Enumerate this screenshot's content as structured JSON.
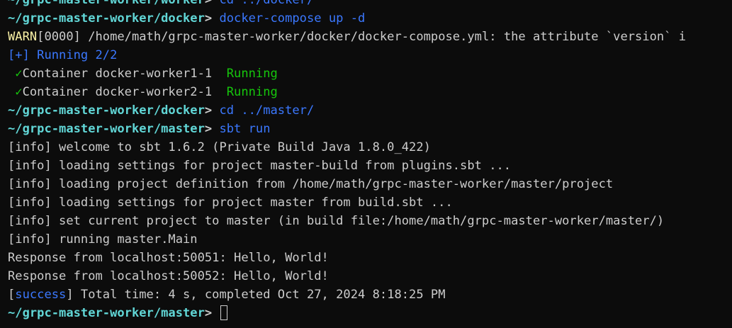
{
  "lines": [
    {
      "path": "~/grpc-master-worker/worker",
      "sym": ">",
      "cmd1": "cd",
      "cmd2": " ../docker/"
    },
    {
      "path": "~/grpc-master-worker/docker",
      "sym": ">",
      "cmd1": "docker-compose",
      "cmd2": " up -d"
    },
    {
      "warn_tag": "WARN",
      "warn_rest": "[0000] /home/math/grpc-master-worker/docker/docker-compose.yml: the attribute `version` i"
    },
    {
      "text": "[+] Running 2/2"
    },
    {
      "check": "✓",
      "label": "Container docker-worker1-1",
      "status": "Running"
    },
    {
      "check": "✓",
      "label": "Container docker-worker2-1",
      "status": "Running"
    },
    {
      "path": "~/grpc-master-worker/docker",
      "sym": ">",
      "cmd1": "cd",
      "cmd2": " ../master/"
    },
    {
      "path": "~/grpc-master-worker/master",
      "sym": ">",
      "cmd1": "sbt",
      "cmd2": " run"
    },
    {
      "text": "[info] welcome to sbt 1.6.2 (Private Build Java 1.8.0_422)"
    },
    {
      "text": "[info] loading settings for project master-build from plugins.sbt ..."
    },
    {
      "text": "[info] loading project definition from /home/math/grpc-master-worker/master/project"
    },
    {
      "text": "[info] loading settings for project master from build.sbt ..."
    },
    {
      "text": "[info] set current project to master (in build file:/home/math/grpc-master-worker/master/)"
    },
    {
      "text": "[info] running master.Main"
    },
    {
      "text": "Response from localhost:50051: Hello, World!"
    },
    {
      "text": "Response from localhost:50052: Hello, World!"
    },
    {
      "open": "[",
      "tag": "success",
      "rest": "] Total time: 4 s, completed Oct 27, 2024 8:18:25 PM"
    },
    {
      "path": "~/grpc-master-worker/master",
      "sym": ">"
    }
  ],
  "colors": {
    "background": "#0c0c0c",
    "foreground": "#cccccc",
    "path": "#61d6d6",
    "command": "#3b78ff",
    "warn": "#f9f1a5",
    "running": "#16c60c"
  }
}
